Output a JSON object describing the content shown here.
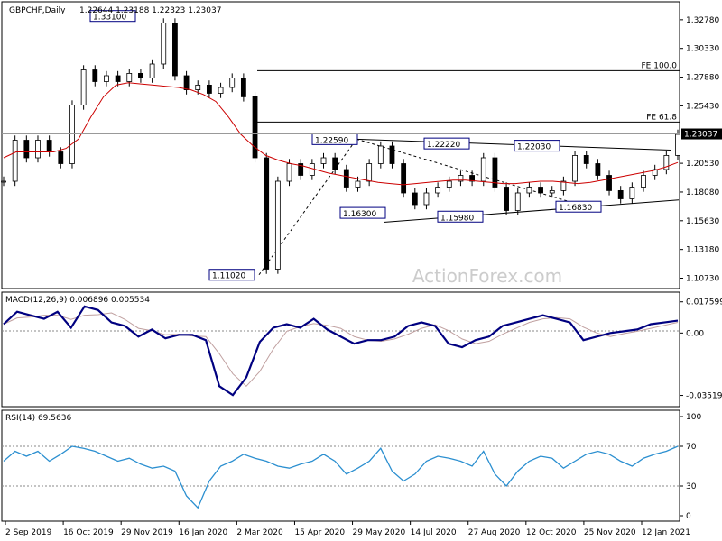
{
  "header": {
    "symbol": "GBPCHF,Daily",
    "ohlc": "1.22644 1.23188 1.22323 1.23037"
  },
  "watermark": "ActionForex.com",
  "colors": {
    "candle": "#000000",
    "ma": "#cc0000",
    "macd": "#000080",
    "signal": "#c0a0a0",
    "rsi": "#2b8fd0",
    "label_border": "#000080"
  },
  "chart_data": [
    {
      "type": "candlestick",
      "panel": "price",
      "ylim": [
        1.1,
        1.34
      ],
      "yticks": [
        "1.32780",
        "1.30330",
        "1.27880",
        "1.25430",
        "1.20530",
        "1.18080",
        "1.15630",
        "1.13180",
        "1.10730"
      ],
      "current_price": "1.23037",
      "ma_series": [
        1.21,
        1.215,
        1.215,
        1.215,
        1.215,
        1.218,
        1.226,
        1.245,
        1.262,
        1.272,
        1.274,
        1.273,
        1.272,
        1.271,
        1.27,
        1.268,
        1.264,
        1.258,
        1.245,
        1.23,
        1.22,
        1.212,
        1.208,
        1.205,
        1.203,
        1.2,
        1.197,
        1.195,
        1.193,
        1.191,
        1.189,
        1.188,
        1.187,
        1.188,
        1.189,
        1.19,
        1.191,
        1.191,
        1.19,
        1.189,
        1.188,
        1.188,
        1.189,
        1.19,
        1.19,
        1.189,
        1.188,
        1.189,
        1.191,
        1.193,
        1.195,
        1.197,
        1.199,
        1.202,
        1.206
      ],
      "close_series": [
        1.19,
        1.225,
        1.21,
        1.225,
        1.215,
        1.205,
        1.255,
        1.285,
        1.275,
        1.28,
        1.275,
        1.282,
        1.278,
        1.29,
        1.325,
        1.28,
        1.268,
        1.272,
        1.265,
        1.27,
        1.278,
        1.262,
        1.21,
        1.115,
        1.19,
        1.205,
        1.195,
        1.205,
        1.21,
        1.2,
        1.185,
        1.19,
        1.205,
        1.22,
        1.205,
        1.18,
        1.17,
        1.18,
        1.185,
        1.19,
        1.195,
        1.19,
        1.21,
        1.185,
        1.165,
        1.18,
        1.185,
        1.18,
        1.182,
        1.19,
        1.212,
        1.205,
        1.195,
        1.182,
        1.175,
        1.185,
        1.195,
        1.2,
        1.212,
        1.23
      ],
      "price_labels": [
        {
          "text": "1.33100",
          "value": 1.331
        },
        {
          "text": "1.11020",
          "value": 1.1102
        },
        {
          "text": "1.22590",
          "value": 1.2259
        },
        {
          "text": "1.16300",
          "value": 1.163
        },
        {
          "text": "1.22220",
          "value": 1.2222
        },
        {
          "text": "1.15980",
          "value": 1.1598
        },
        {
          "text": "1.22030",
          "value": 1.2203
        },
        {
          "text": "1.16830",
          "value": 1.1683
        }
      ],
      "fib_levels": [
        {
          "text": "FE 100.0",
          "value": 1.2843
        },
        {
          "text": "FE 61.8",
          "value": 1.2405
        }
      ]
    },
    {
      "type": "line",
      "panel": "MACD",
      "label": "MACD(12,26,9) 0.006896 0.005534",
      "yticks": [
        "0.017599",
        "0.00",
        "-0.035194"
      ],
      "ylim": [
        -0.04,
        0.02
      ],
      "macd": [
        0.005,
        0.012,
        0.01,
        0.008,
        0.012,
        0.003,
        0.015,
        0.013,
        0.006,
        0.004,
        -0.002,
        0.002,
        -0.003,
        -0.001,
        -0.001,
        -0.004,
        -0.03,
        -0.035,
        -0.025,
        -0.005,
        0.003,
        0.005,
        0.003,
        0.008,
        0.002,
        -0.002,
        -0.006,
        -0.004,
        -0.004,
        -0.002,
        0.004,
        0.006,
        0.004,
        -0.006,
        -0.008,
        -0.004,
        -0.002,
        0.004,
        0.006,
        0.008,
        0.01,
        0.008,
        0.006,
        -0.004,
        -0.002,
        0.0,
        0.001,
        0.002,
        0.005,
        0.006,
        0.007
      ]
    },
    {
      "type": "line",
      "panel": "RSI",
      "label": "RSI(14) 69.5636",
      "yticks": [
        "100",
        "70",
        "30",
        "0"
      ],
      "ylim": [
        0,
        100
      ],
      "rsi": [
        55,
        65,
        60,
        65,
        55,
        62,
        70,
        68,
        65,
        60,
        55,
        58,
        52,
        48,
        50,
        45,
        20,
        8,
        35,
        50,
        55,
        62,
        58,
        55,
        50,
        48,
        52,
        55,
        62,
        55,
        42,
        48,
        55,
        68,
        45,
        35,
        42,
        55,
        60,
        58,
        55,
        50,
        65,
        42,
        30,
        45,
        55,
        60,
        58,
        48,
        55,
        62,
        65,
        62,
        55,
        50,
        58,
        62,
        65,
        70
      ]
    },
    {
      "type": "axis",
      "xticks": [
        "2 Sep 2019",
        "16 Oct 2019",
        "29 Nov 2019",
        "16 Jan 2020",
        "2 Mar 2020",
        "15 Apr 2020",
        "29 May 2020",
        "14 Jul 2020",
        "27 Aug 2020",
        "12 Oct 2020",
        "25 Nov 2020",
        "12 Jan 2021"
      ]
    }
  ]
}
